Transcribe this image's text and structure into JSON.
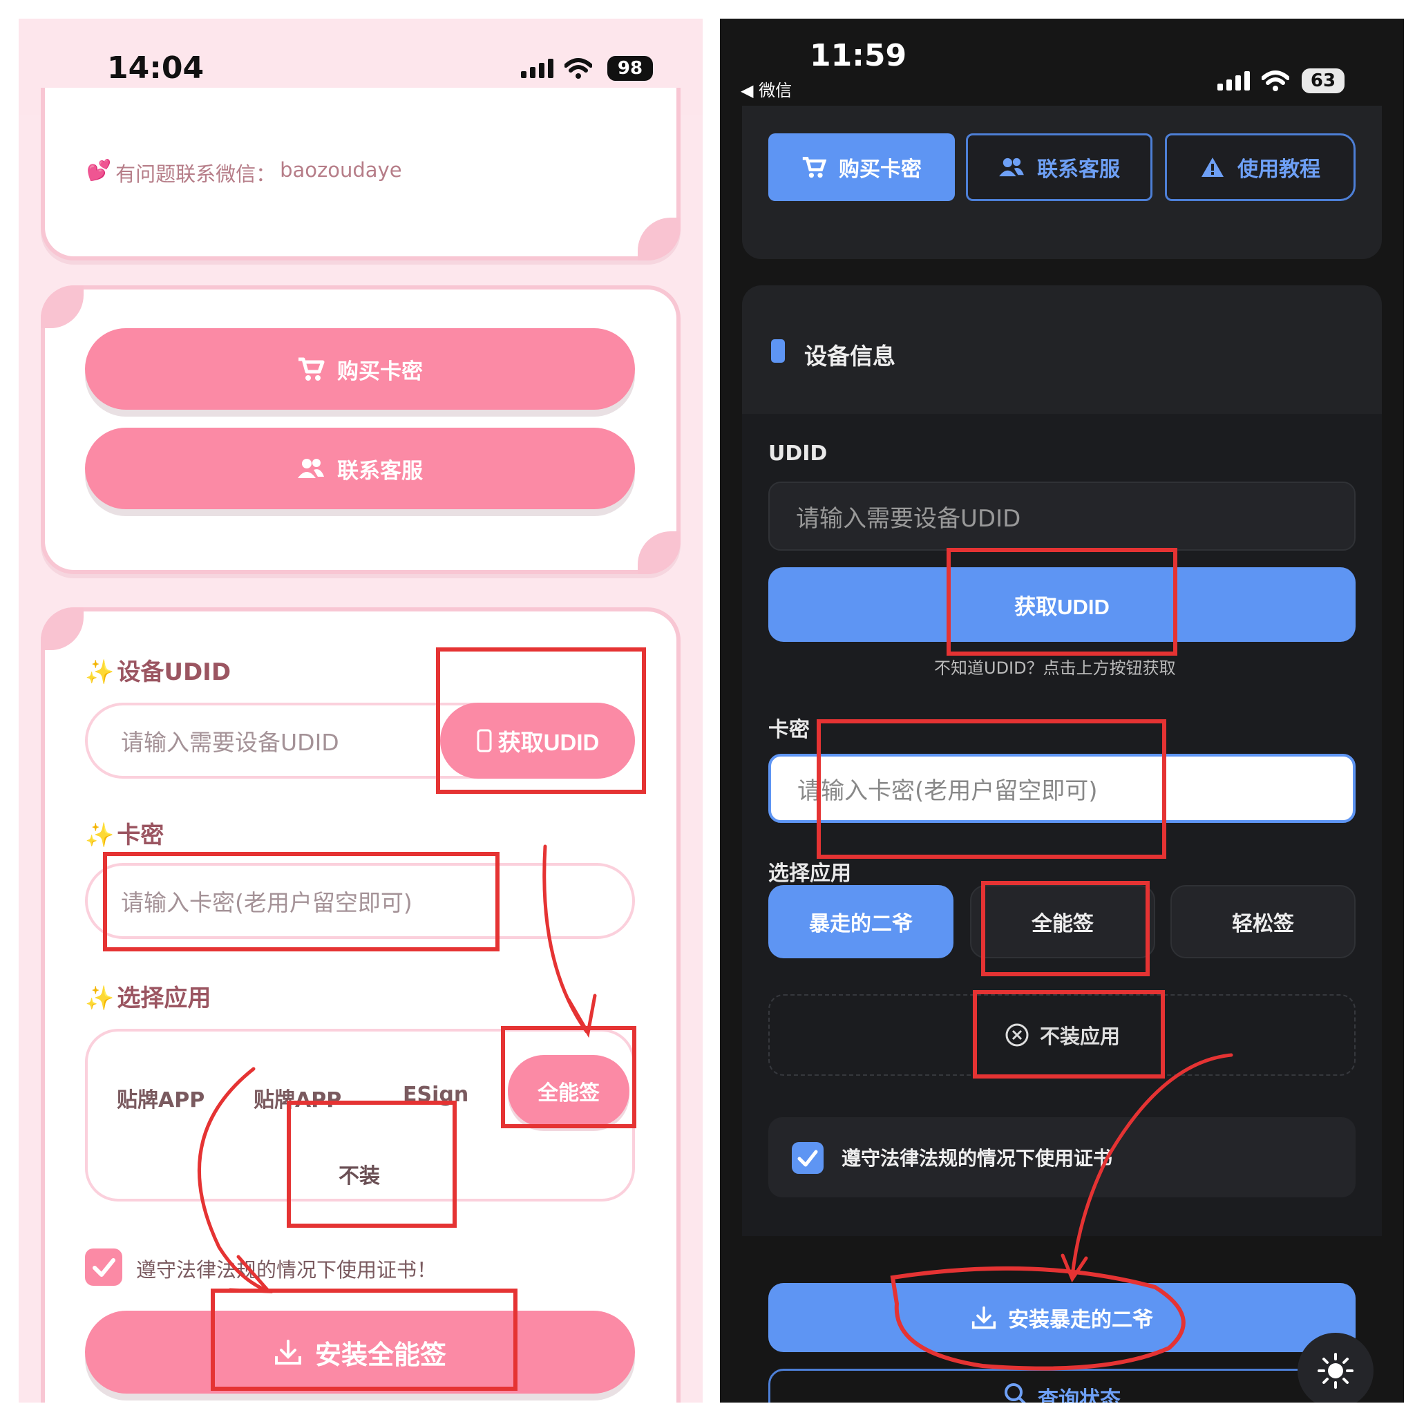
{
  "left": {
    "status": {
      "time": "14:04",
      "battery": "98"
    },
    "contact": {
      "emoji": "💕",
      "label": "有问题联系微信：",
      "wechat": "baozoudaye"
    },
    "buttons": {
      "buy": "购买卡密",
      "service": "联系客服"
    },
    "udid": {
      "label": "设备UDID",
      "placeholder": "请输入需要设备UDID",
      "get_button": "获取UDID"
    },
    "card_key": {
      "label": "卡密",
      "placeholder": "请输入卡密(老用户留空即可)"
    },
    "apps": {
      "label": "选择应用",
      "options": [
        "贴牌APP",
        "贴牌APP",
        "ESign",
        "全能签"
      ],
      "none": "不装"
    },
    "agree": "遵守法律法规的情况下使用证书！",
    "install": "安装全能签"
  },
  "right": {
    "status": {
      "time": "11:59",
      "back": "◀ 微信",
      "battery": "63"
    },
    "top_buttons": {
      "buy": "购买卡密",
      "service": "联系客服",
      "tutorial": "使用教程"
    },
    "device_info": "设备信息",
    "udid": {
      "label": "UDID",
      "placeholder": "请输入需要设备UDID",
      "get_button": "获取UDID",
      "hint": "不知道UDID？点击上方按钮获取"
    },
    "card_key": {
      "label": "卡密",
      "placeholder": "请输入卡密(老用户留空即可)"
    },
    "apps": {
      "label": "选择应用",
      "options": [
        "暴走的二爷",
        "全能签",
        "轻松签"
      ],
      "none": "不装应用"
    },
    "agree": "遵守法律法规的情况下使用证书",
    "install": "安装暴走的二爷",
    "query": "查询状态"
  },
  "colors": {
    "pink_button": "#fb8aa5",
    "pink_border": "#f8c6d3",
    "blue_button": "#5e95f3",
    "dark_bg": "#161616",
    "annotation_red": "#e53333"
  }
}
